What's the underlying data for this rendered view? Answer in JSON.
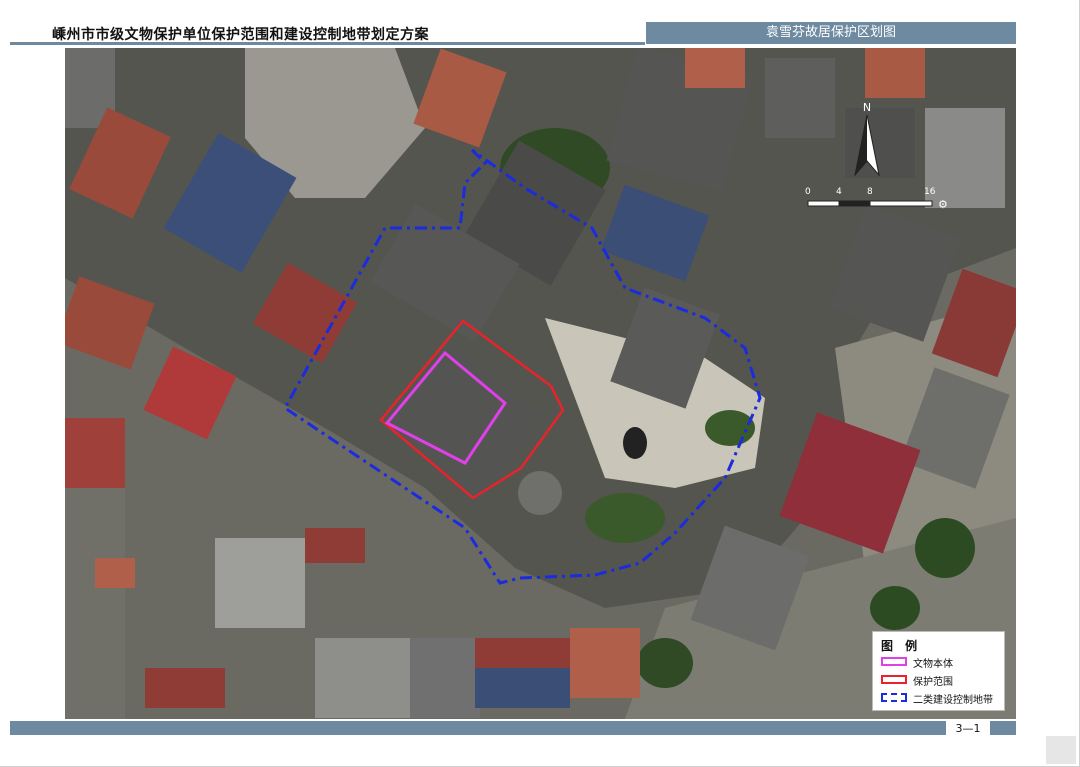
{
  "header": {
    "title": "嵊州市市级文物保护单位保护范围和建设控制地带划定方案",
    "section": "袁雪芬故居保护区划图"
  },
  "map": {
    "north_label": "N",
    "scale_ticks": [
      "0",
      "4",
      "8",
      "16"
    ],
    "scale_unit_icon": "gear-icon"
  },
  "legend": {
    "title": "图 例",
    "items": [
      {
        "label": "文物本体",
        "color": "#e040e8",
        "style": "solid"
      },
      {
        "label": "保护范围",
        "color": "#e8232a",
        "style": "solid"
      },
      {
        "label": "二类建设控制地带",
        "color": "#1a2be0",
        "style": "dashed"
      }
    ]
  },
  "footer": {
    "page_number": "3—1"
  }
}
